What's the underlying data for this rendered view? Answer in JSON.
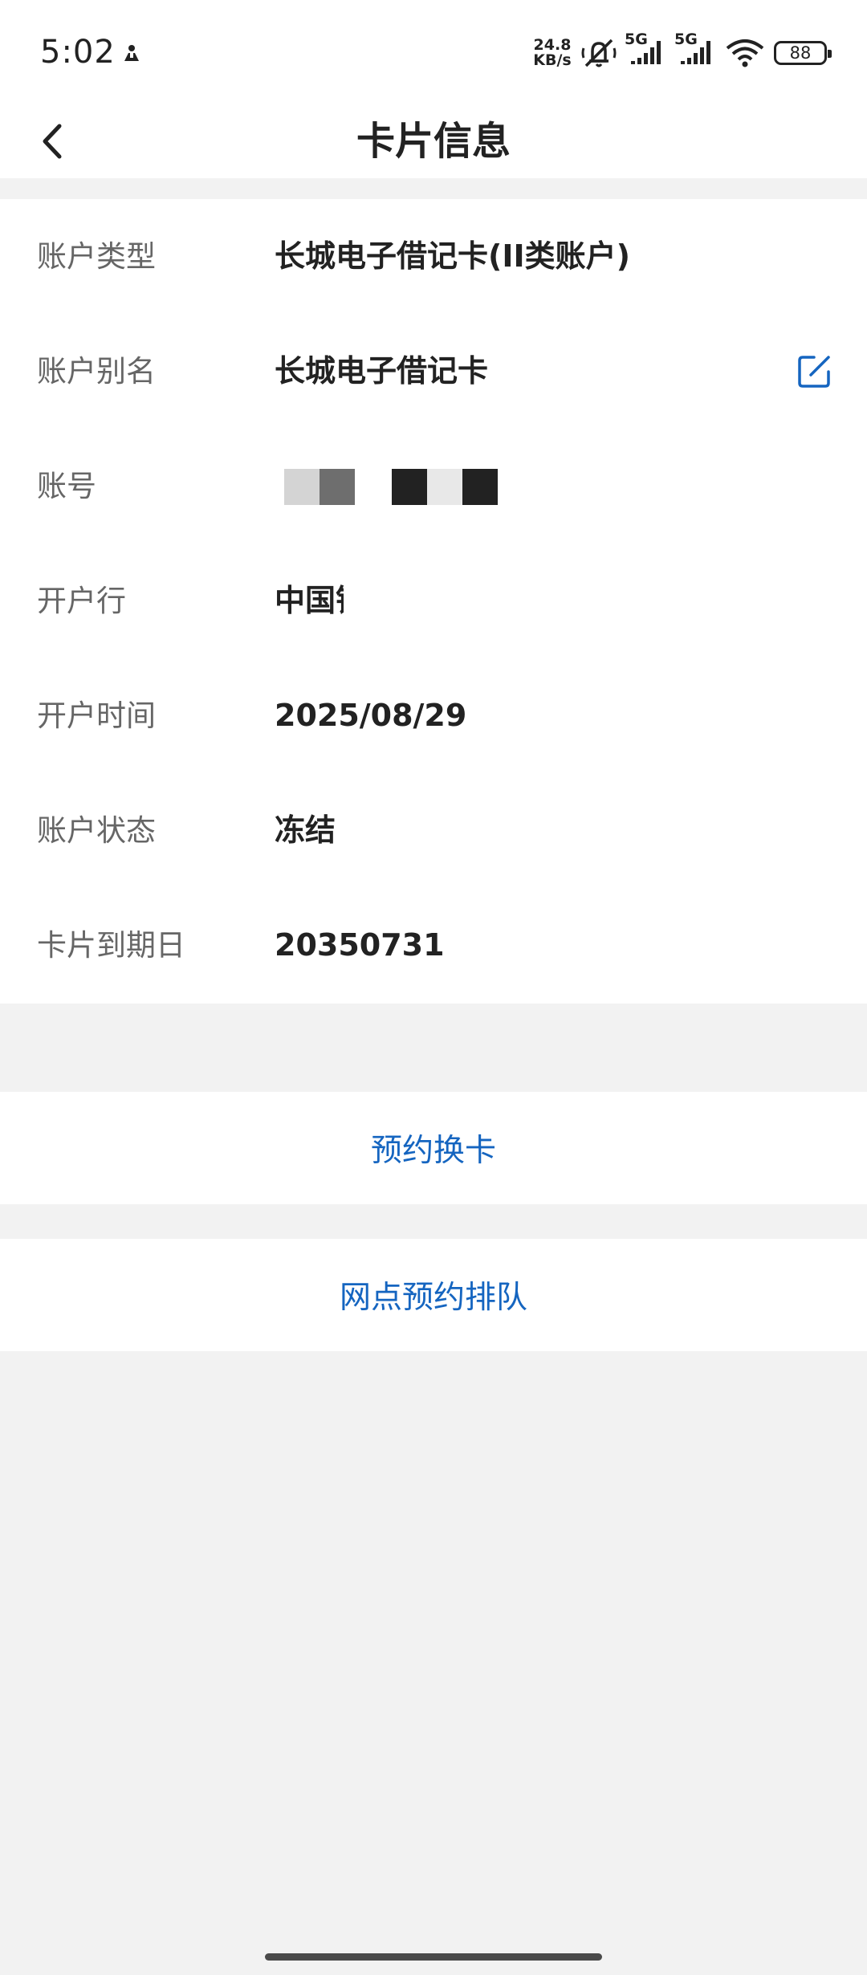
{
  "status_bar": {
    "time": "5:02",
    "net_speed_value": "24.8",
    "net_speed_unit": "KB/s",
    "signal1_label": "5G",
    "signal2_label": "5G",
    "battery_level": "88",
    "icons": [
      "person-icon",
      "mute-bell-icon",
      "signal-icon",
      "signal-icon",
      "wifi-icon",
      "battery-icon"
    ]
  },
  "header": {
    "title": "卡片信息",
    "back_icon": "chevron-left-icon"
  },
  "info_rows": [
    {
      "label": "账户类型",
      "value": "长城电子借记卡(II类账户)"
    },
    {
      "label": "账户别名",
      "value": "长城电子借记卡",
      "action_icon": "edit-icon"
    },
    {
      "label": "账号",
      "value": ""
    },
    {
      "label": "开户行",
      "value": "中国银"
    },
    {
      "label": "开户时间",
      "value": "2025/08/29"
    },
    {
      "label": "账户状态",
      "value": "冻结"
    },
    {
      "label": "卡片到期日",
      "value": "20350731"
    }
  ],
  "actions": {
    "reserve_card": "预约换卡",
    "branch_queue": "网点预约排队"
  },
  "colors": {
    "accent": "#1565c0",
    "background": "#f2f2f2",
    "card": "#ffffff",
    "label": "#666666",
    "value": "#222222"
  }
}
